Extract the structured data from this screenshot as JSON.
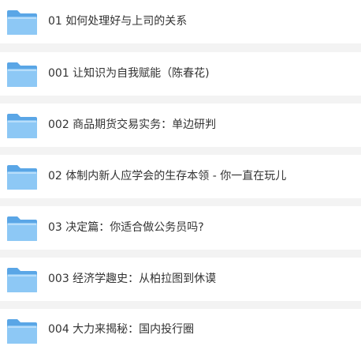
{
  "folders": [
    {
      "name": "01 如何处理好与上司的关系",
      "icon": "folder-icon"
    },
    {
      "name": "001 让知识为自我赋能（陈春花)",
      "icon": "folder-icon"
    },
    {
      "name": "002 商品期货交易实务：单边研判",
      "icon": "folder-icon"
    },
    {
      "name": "02 体制内新人应学会的生存本领 - 你一直在玩儿",
      "icon": "folder-icon"
    },
    {
      "name": "03 决定篇：你适合做公务员吗?",
      "icon": "folder-icon"
    },
    {
      "name": "003 经济学趣史：从柏拉图到休谟",
      "icon": "folder-icon"
    },
    {
      "name": "004 大力来揭秘：国内投行圈",
      "icon": "folder-icon"
    }
  ],
  "colors": {
    "folder_back": "#5aa6e6",
    "folder_front": "#8dc8f5",
    "folder_highlight": "#b7ddfa",
    "row_background": "#ffffff",
    "separator": "#f3f3f3",
    "text": "#333333"
  }
}
